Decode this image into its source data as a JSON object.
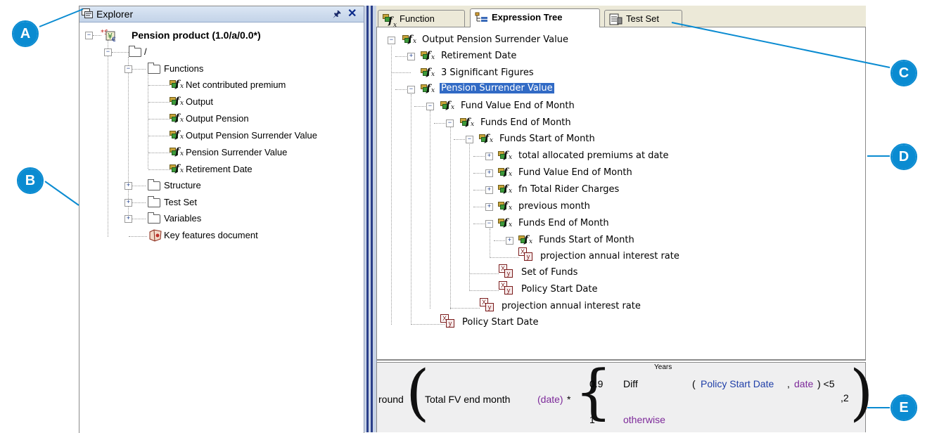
{
  "explorer": {
    "title": "Explorer",
    "pin_glyph": "↑",
    "close_glyph": "✕",
    "product": "Pension product (1.0/a/0.0*)",
    "root_folder": "/",
    "folders": {
      "functions": "Functions",
      "structure": "Structure",
      "test_set": "Test Set",
      "variables": "Variables"
    },
    "functions": [
      "Net contributed premium",
      "Output",
      "Output Pension",
      "Output Pension Surrender Value",
      "Pension Surrender Value",
      "Retirement Date"
    ],
    "document": "Key features document"
  },
  "tabs": [
    {
      "label": "Function",
      "icon": "function-icon"
    },
    {
      "label": "Expression Tree",
      "icon": "expression-tree-icon",
      "active": true
    },
    {
      "label": "Test Set",
      "icon": "test-set-icon"
    }
  ],
  "tree": [
    {
      "label": "Output Pension Surrender Value",
      "type": "function"
    },
    {
      "label": "Retirement Date",
      "type": "function"
    },
    {
      "label": "3 Significant Figures",
      "type": "function"
    },
    {
      "label": "Pension Surrender Value",
      "type": "function",
      "selected": true
    },
    {
      "label": "Fund Value End of Month",
      "type": "function"
    },
    {
      "label": "Funds End of Month",
      "type": "function"
    },
    {
      "label": "Funds Start of Month",
      "type": "function"
    },
    {
      "label": "total allocated premiums at date",
      "type": "function"
    },
    {
      "label": "Fund Value End of Month",
      "type": "function"
    },
    {
      "label": "fn Total Rider Charges",
      "type": "function"
    },
    {
      "label": "previous month",
      "type": "function"
    },
    {
      "label": "Funds End of Month",
      "type": "function"
    },
    {
      "label": "Funds Start of Month",
      "type": "function"
    },
    {
      "label": "projection annual interest rate",
      "type": "variable"
    },
    {
      "label": "Set of Funds",
      "type": "variable"
    },
    {
      "label": "Policy Start Date",
      "type": "variable"
    },
    {
      "label": "projection annual interest rate",
      "type": "variable"
    },
    {
      "label": "Policy Start Date",
      "type": "variable"
    }
  ],
  "formula": {
    "round": "round",
    "total_fv": "Total FV end month",
    "arg_date": "(date)",
    "times": "*",
    "val_1": "0.9",
    "diff": "Diff",
    "years": "Years",
    "paren_open": "(",
    "policy_start_date": "Policy Start Date",
    "comma": ",",
    "date": "date",
    "paren_close_lt": ") <5",
    "digits": ",2",
    "val_2": "1",
    "otherwise": "otherwise"
  },
  "callouts": [
    "A",
    "B",
    "C",
    "D",
    "E"
  ],
  "colors": {
    "callout": "#0a8bd1",
    "selection": "#316ac5",
    "splitter": "#2b3f8a"
  }
}
